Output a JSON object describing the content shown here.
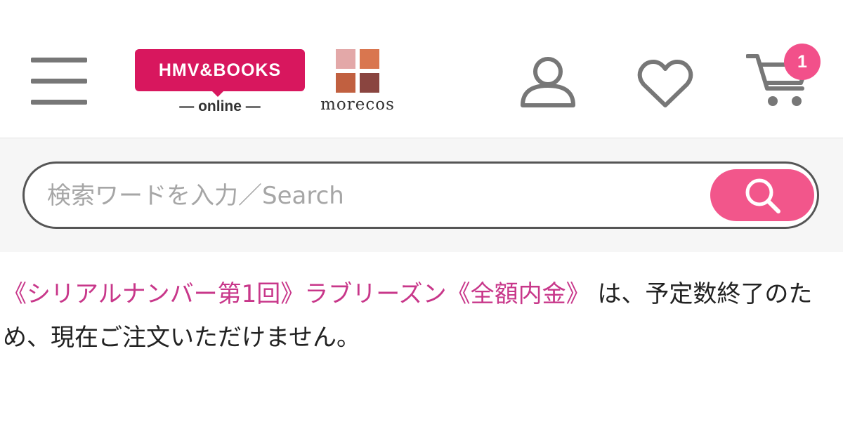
{
  "header": {
    "logo_hmv_text": "HMV&BOOKS",
    "logo_hmv_sub": "— online —",
    "logo_morecos_text": "morecos",
    "cart_count": "1",
    "icons": {
      "menu": "hamburger-menu-icon",
      "account": "user-icon",
      "favorites": "heart-icon",
      "cart": "cart-icon"
    }
  },
  "search": {
    "placeholder": "検索ワードを入力／Search",
    "value": "",
    "button_icon": "search-icon"
  },
  "message": {
    "product_name": "《シリアルナンバー第1回》ラブリーズン《全額内金》",
    "text": " は、予定数終了のため、現在ご注文いただけません。"
  },
  "colors": {
    "hmv_brand": "#d8175e",
    "search_button": "#f2568b",
    "cart_badge": "#f2508a",
    "product_link": "#c8378a",
    "icon_gray": "#777777",
    "morecos_squares": [
      "#e3a8a8",
      "#d9764f",
      "#c16040",
      "#8a4540"
    ]
  }
}
